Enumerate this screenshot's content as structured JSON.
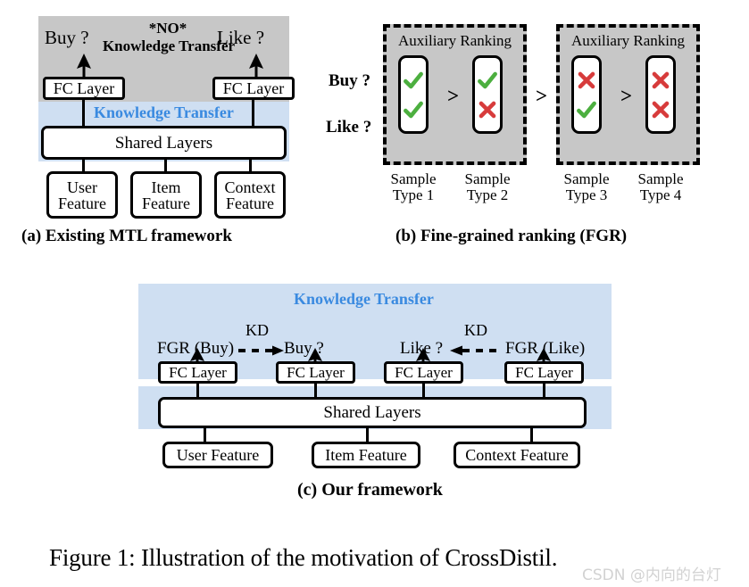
{
  "figure": {
    "caption": "Figure 1: Illustration of the motivation of CrossDistil.",
    "watermark": "CSDN @内向的台灯"
  },
  "colors": {
    "gray_panel": "#c7c7c7",
    "blue_panel": "#cfdff2",
    "knowledge_transfer_text": "#3a8ae0",
    "check_green": "#4caf3f",
    "cross_red": "#d73b3b",
    "stroke": "#000000"
  },
  "panel_a": {
    "caption": "(a)  Existing MTL framework",
    "no_label_line1": "*NO*",
    "no_label_line2": "Knowledge Transfer",
    "knowledge_transfer_label": "Knowledge Transfer",
    "task_left": "Buy ?",
    "task_right": "Like ?",
    "fc_left": "FC Layer",
    "fc_right": "FC Layer",
    "shared_layers": "Shared Layers",
    "features": [
      {
        "line1": "User",
        "line2": "Feature"
      },
      {
        "line1": "Item",
        "line2": "Feature"
      },
      {
        "line1": "Context",
        "line2": "Feature"
      }
    ]
  },
  "panel_b": {
    "caption": "(b) Fine-grained ranking (FGR)",
    "row_labels": [
      "Buy ?",
      "Like ?"
    ],
    "group_separator": ">",
    "groups": [
      {
        "title": "Auxiliary Ranking",
        "inner_separator": ">",
        "samples": [
          {
            "name_line1": "Sample",
            "name_line2": "Type 1",
            "buy": "check",
            "like": "check"
          },
          {
            "name_line1": "Sample",
            "name_line2": "Type 2",
            "buy": "check",
            "like": "cross"
          }
        ]
      },
      {
        "title": "Auxiliary Ranking",
        "inner_separator": ">",
        "samples": [
          {
            "name_line1": "Sample",
            "name_line2": "Type 3",
            "buy": "cross",
            "like": "check"
          },
          {
            "name_line1": "Sample",
            "name_line2": "Type 4",
            "buy": "cross",
            "like": "cross"
          }
        ]
      }
    ]
  },
  "panel_c": {
    "caption": "(c) Our framework",
    "knowledge_transfer_label": "Knowledge Transfer",
    "kd_left_label": "KD",
    "kd_right_label": "KD",
    "heads": [
      {
        "label": "FGR (Buy)",
        "fc": "FC Layer"
      },
      {
        "label": "Buy ?",
        "fc": "FC Layer"
      },
      {
        "label": "Like ?",
        "fc": "FC Layer"
      },
      {
        "label": "FGR (Like)",
        "fc": "FC Layer"
      }
    ],
    "shared_layers": "Shared Layers",
    "features": [
      "User Feature",
      "Item Feature",
      "Context Feature"
    ]
  }
}
